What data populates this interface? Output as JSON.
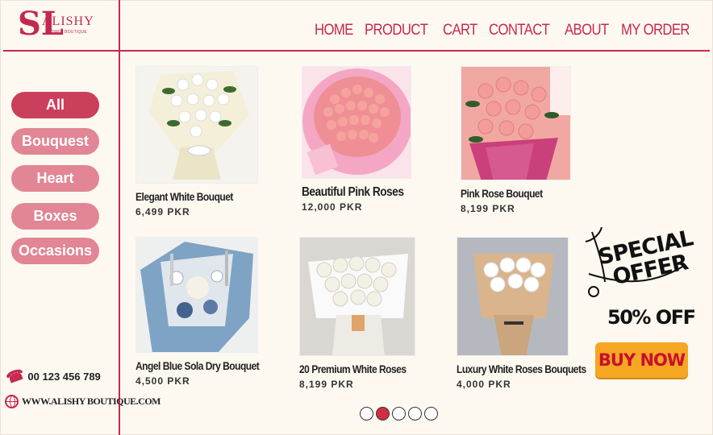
{
  "brand": {
    "mark": "SL",
    "name": "ALISHY",
    "tagline": "FLOWER BOUTIQUE",
    "accent": "#c8284f"
  },
  "nav": {
    "items": [
      "HOME",
      "PRODUCT",
      "CART",
      "CONTACT",
      "ABOUT",
      "MY ORDER"
    ]
  },
  "categories": [
    {
      "label": "All",
      "active": true
    },
    {
      "label": "Bouquest",
      "active": false
    },
    {
      "label": "Heart",
      "active": false
    },
    {
      "label": "Boxes",
      "active": false
    },
    {
      "label": "Occasions",
      "active": false
    }
  ],
  "contact": {
    "phone": "00 123 456 789",
    "website": "WWW.ALISHY BOUTIQUE.COM"
  },
  "products": [
    {
      "title": "Elegant White Bouquet",
      "price": "6,499  PKR"
    },
    {
      "title": "Beautiful  Pink   Roses",
      "price": "12,000  PKR"
    },
    {
      "title": "Pink Rose Bouquet",
      "price": "8,199  PKR"
    },
    {
      "title": "Angel Blue Sola Dry Bouquet",
      "price": "4,500  PKR"
    },
    {
      "title": "20 Premium White Roses",
      "price": "8,199  PKR"
    },
    {
      "title": "Luxury White Roses  Bouquets",
      "price": "4,000  PKR"
    }
  ],
  "offer": {
    "line1": "SPECIAL",
    "line2": "OFFER",
    "discount": "50% OFF",
    "button": "BUY NOW"
  },
  "pagination": {
    "pages": 5,
    "current": 2
  },
  "colors": {
    "background": "#fdf9f1",
    "category_active": "#cb3f5c",
    "category": "#e28594",
    "buy_button": "#f5a623",
    "buy_text": "#c8102e"
  }
}
